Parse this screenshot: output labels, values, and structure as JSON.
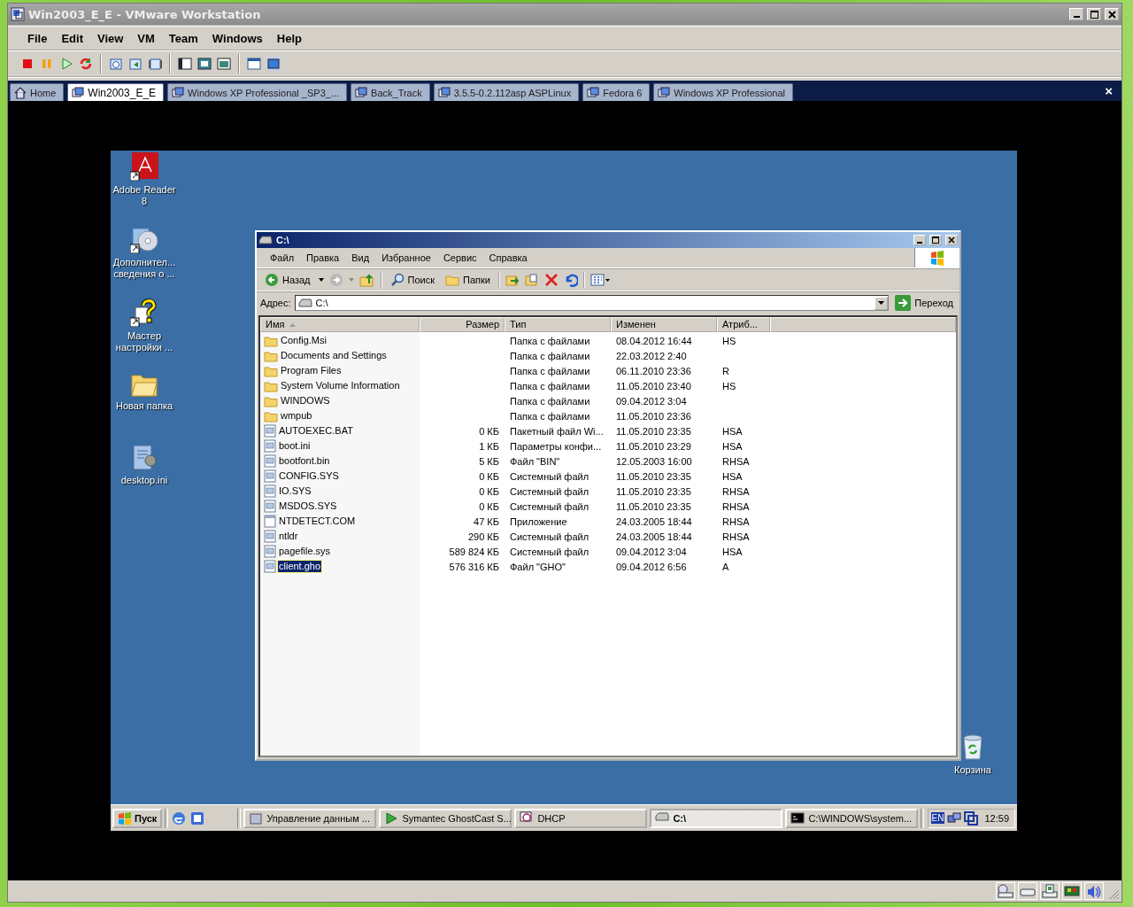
{
  "window": {
    "title": "Win2003_E_E - VMware Workstation"
  },
  "menu": [
    "File",
    "Edit",
    "View",
    "VM",
    "Team",
    "Windows",
    "Help"
  ],
  "tabs": [
    {
      "label": "Home",
      "kind": "home",
      "selected": false
    },
    {
      "label": "Win2003_E_E",
      "kind": "vm",
      "selected": true
    },
    {
      "label": "Windows XP Professional _SP3_...",
      "kind": "vm",
      "selected": false
    },
    {
      "label": "Back_Track",
      "kind": "vm",
      "selected": false
    },
    {
      "label": "3.5.5-0.2.112asp ASPLinux",
      "kind": "vm",
      "selected": false
    },
    {
      "label": "Fedora 6",
      "kind": "vm",
      "selected": false
    },
    {
      "label": "Windows XP Professional",
      "kind": "vm",
      "selected": false
    }
  ],
  "tab_close": "×",
  "desktop_icons": [
    {
      "label": "Adobe Reader 8",
      "kind": "pdf"
    },
    {
      "label": "Дополнител... сведения о ...",
      "kind": "disc"
    },
    {
      "label": "Мастер настройки ...",
      "kind": "help"
    },
    {
      "label": "Новая папка",
      "kind": "folder"
    },
    {
      "label": "desktop.ini",
      "kind": "ini"
    }
  ],
  "recycle_bin": {
    "label": "Корзина"
  },
  "explorer": {
    "title": "C:\\",
    "menu": [
      "Файл",
      "Правка",
      "Вид",
      "Избранное",
      "Сервис",
      "Справка"
    ],
    "toolbar": {
      "back": "Назад",
      "search": "Поиск",
      "folders": "Папки"
    },
    "address": {
      "label": "Адрес:",
      "value": "C:\\",
      "go": "Переход"
    },
    "columns": [
      "Имя",
      "Размер",
      "Тип",
      "Изменен",
      "Атриб..."
    ],
    "rows": [
      {
        "name": "Config.Msi",
        "kind": "folder",
        "type": "Папка с файлами",
        "modified": "08.04.2012 16:44",
        "attributes": "HS",
        "selected": false
      },
      {
        "name": "Documents and Settings",
        "kind": "folder",
        "type": "Папка с файлами",
        "modified": "22.03.2012 2:40",
        "selected": false
      },
      {
        "name": "Program Files",
        "kind": "folder",
        "type": "Папка с файлами",
        "modified": "06.11.2010 23:36",
        "attributes": "R",
        "selected": false
      },
      {
        "name": "System Volume Information",
        "kind": "folder",
        "type": "Папка с файлами",
        "modified": "11.05.2010 23:40",
        "attributes": "HS",
        "selected": false
      },
      {
        "name": "WINDOWS",
        "kind": "folder",
        "type": "Папка с файлами",
        "modified": "09.04.2012 3:04",
        "selected": false
      },
      {
        "name": "wmpub",
        "kind": "folder",
        "type": "Папка с файлами",
        "modified": "11.05.2010 23:36",
        "selected": false
      },
      {
        "name": "AUTOEXEC.BAT",
        "kind": "file",
        "size": "0 КБ",
        "type": "Пакетный файл Wi...",
        "modified": "11.05.2010 23:35",
        "attributes": "HSA",
        "selected": false
      },
      {
        "name": "boot.ini",
        "kind": "file",
        "size": "1 КБ",
        "type": "Параметры конфи...",
        "modified": "11.05.2010 23:29",
        "attributes": "HSA",
        "selected": false
      },
      {
        "name": "bootfont.bin",
        "kind": "file",
        "size": "5 КБ",
        "type": "Файл \"BIN\"",
        "modified": "12.05.2003 16:00",
        "attributes": "RHSA",
        "selected": false
      },
      {
        "name": "CONFIG.SYS",
        "kind": "file",
        "size": "0 КБ",
        "type": "Системный файл",
        "modified": "11.05.2010 23:35",
        "attributes": "HSA",
        "selected": false
      },
      {
        "name": "IO.SYS",
        "kind": "file",
        "size": "0 КБ",
        "type": "Системный файл",
        "modified": "11.05.2010 23:35",
        "attributes": "RHSA",
        "selected": false
      },
      {
        "name": "MSDOS.SYS",
        "kind": "file",
        "size": "0 КБ",
        "type": "Системный файл",
        "modified": "11.05.2010 23:35",
        "attributes": "RHSA",
        "selected": false
      },
      {
        "name": "NTDETECT.COM",
        "kind": "app",
        "size": "47 КБ",
        "type": "Приложение",
        "modified": "24.03.2005 18:44",
        "attributes": "RHSA",
        "selected": false
      },
      {
        "name": "ntldr",
        "kind": "file",
        "size": "290 КБ",
        "type": "Системный файл",
        "modified": "24.03.2005 18:44",
        "attributes": "RHSA",
        "selected": false
      },
      {
        "name": "pagefile.sys",
        "kind": "file",
        "size": "589 824 КБ",
        "type": "Системный файл",
        "modified": "09.04.2012 3:04",
        "attributes": "HSA",
        "selected": false
      },
      {
        "name": "client.gho",
        "kind": "file",
        "size": "576 316 КБ",
        "type": "Файл \"GHO\"",
        "modified": "09.04.2012 6:56",
        "attributes": "A",
        "selected": true
      }
    ]
  },
  "taskbar": {
    "start": "Пуск",
    "buttons": [
      {
        "label": "Управление данным ...",
        "selected": false
      },
      {
        "label": "Symantec GhostCast S...",
        "selected": false
      },
      {
        "label": "DHCP",
        "selected": false
      },
      {
        "label": "C:\\",
        "selected": true
      },
      {
        "label": "C:\\WINDOWS\\system...",
        "selected": false
      }
    ],
    "language": "EN",
    "clock": "12:59"
  }
}
